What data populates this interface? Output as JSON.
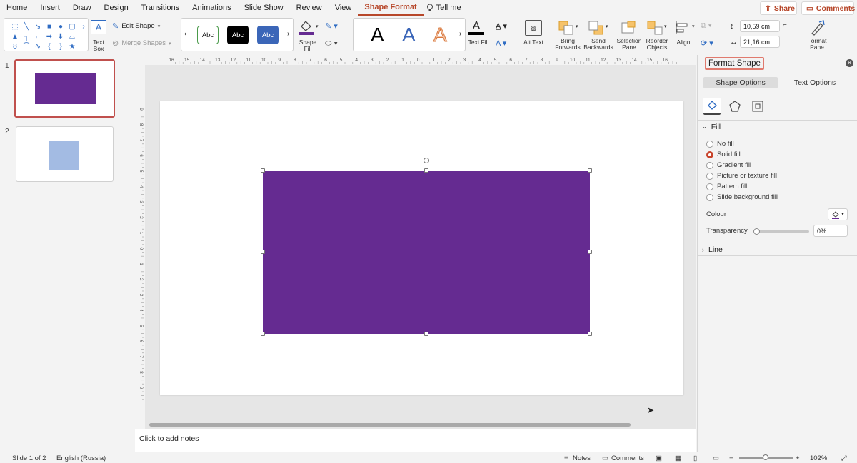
{
  "menu": {
    "items": [
      "Home",
      "Insert",
      "Draw",
      "Design",
      "Transitions",
      "Animations",
      "Slide Show",
      "Review",
      "View",
      "Shape Format"
    ],
    "active": "Shape Format",
    "tell_me": "Tell me",
    "share": "Share",
    "comments": "Comments"
  },
  "ribbon": {
    "text_box": "Text Box",
    "edit_shape": "Edit Shape",
    "merge_shapes": "Merge Shapes",
    "style_sample": "Abc",
    "shape_fill": "Shape Fill",
    "text_fill": "Text Fill",
    "alt_text": "Alt Text",
    "bring_forwards": "Bring Forwards",
    "send_backwards": "Send Backwards",
    "selection_pane": "Selection Pane",
    "reorder_objects": "Reorder Objects",
    "align": "Align",
    "height_value": "10,59 cm",
    "width_value": "21,16 cm",
    "format_pane": "Format Pane",
    "wordart_letter": "A"
  },
  "slides": [
    {
      "number": "1"
    },
    {
      "number": "2"
    }
  ],
  "ruler": {
    "h_ticks": [
      "16",
      "15",
      "14",
      "13",
      "12",
      "11",
      "10",
      "9",
      "8",
      "7",
      "6",
      "5",
      "4",
      "3",
      "2",
      "1",
      "0",
      "1",
      "2",
      "3",
      "4",
      "5",
      "6",
      "7",
      "8",
      "9",
      "10",
      "11",
      "12",
      "13",
      "14",
      "15",
      "16"
    ],
    "v_ticks": [
      "9",
      "8",
      "7",
      "6",
      "5",
      "4",
      "3",
      "2",
      "1",
      "0",
      "1",
      "2",
      "3",
      "4",
      "5",
      "6",
      "7",
      "8",
      "9"
    ]
  },
  "notes_placeholder": "Click to add notes",
  "format_pane": {
    "title": "Format Shape",
    "tabs": [
      "Shape Options",
      "Text Options"
    ],
    "fill_section": "Fill",
    "fill_options": [
      "No fill",
      "Solid fill",
      "Gradient fill",
      "Picture or texture fill",
      "Pattern fill",
      "Slide background fill"
    ],
    "selected_fill": "Solid fill",
    "colour_label": "Colour",
    "transparency_label": "Transparency",
    "transparency_value": "0%",
    "line_section": "Line"
  },
  "colors": {
    "shape_fill": "#652b91",
    "slide2_shape": "#a3bbe3",
    "accent": "#b7472a"
  },
  "status": {
    "slide_of": "Slide 1 of 2",
    "language": "English (Russia)",
    "notes": "Notes",
    "comments": "Comments",
    "zoom": "102%"
  }
}
